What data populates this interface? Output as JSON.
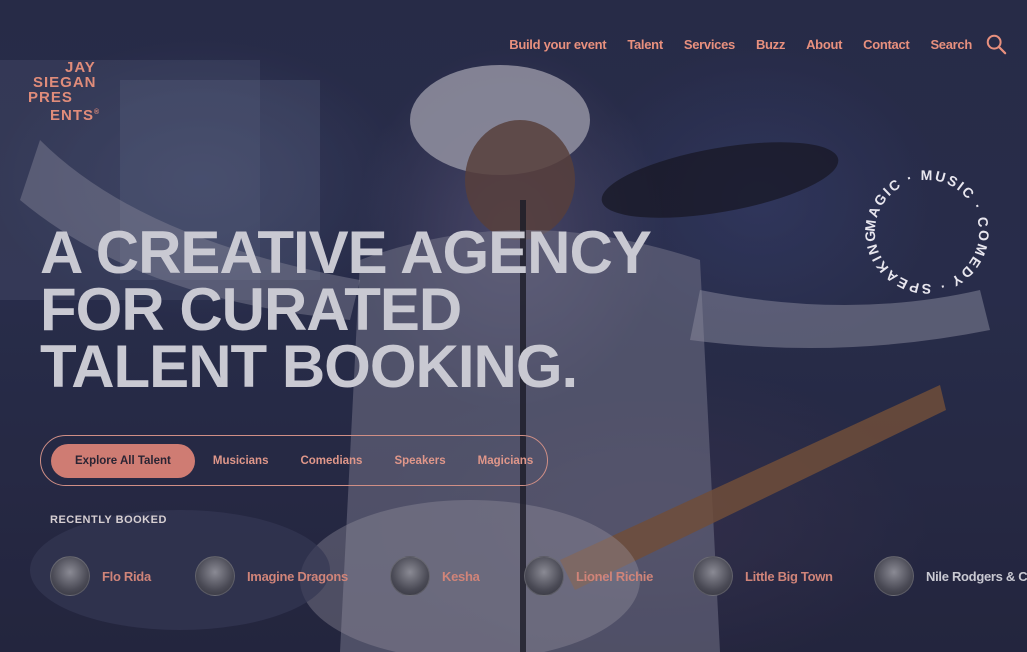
{
  "logo": {
    "lines": [
      "JAY",
      "SIEGAN",
      "PRES",
      "ENTS"
    ],
    "mark": "®"
  },
  "nav": {
    "items": [
      "Build your event",
      "Talent",
      "Services",
      "Buzz",
      "About",
      "Contact",
      "Search"
    ],
    "search_icon": "search-icon"
  },
  "hero": {
    "headline_lines": [
      "A CREATIVE AGENCY",
      "FOR CURATED",
      "TALENT BOOKING."
    ],
    "badge_text": "MAGIC · MUSIC · COMEDY · SPEAKING ·"
  },
  "filters": {
    "items": [
      "Explore All Talent",
      "Musicians",
      "Comedians",
      "Speakers",
      "Magicians"
    ],
    "active": "Explore All Talent"
  },
  "recent": {
    "label": "RECENTLY BOOKED",
    "items": [
      "Flo Rida",
      "Imagine Dragons",
      "Kesha",
      "Lionel Richie",
      "Little Big Town",
      "Nile Rodgers & Chic"
    ]
  },
  "colors": {
    "accent": "#cf7c73",
    "headline": "#c9c9d2",
    "background": "#262a44"
  }
}
